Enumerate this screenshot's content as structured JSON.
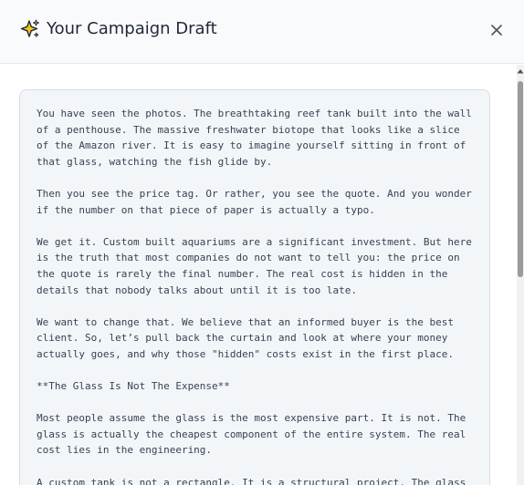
{
  "modal": {
    "title": "Your Campaign Draft",
    "title_icon": "sparkles-icon",
    "close_icon": "close-icon"
  },
  "draft": {
    "paragraphs": [
      "You have seen the photos. The breathtaking reef tank built into the wall of a penthouse. The massive freshwater biotope that looks like a slice of the Amazon river. It is easy to imagine yourself sitting in front of that glass, watching the fish glide by.",
      "Then you see the price tag. Or rather, you see the quote. And you wonder if the number on that piece of paper is actually a typo.",
      "We get it. Custom built aquariums are a significant investment. But here is the truth that most companies do not want to tell you: the price on the quote is rarely the final number. The real cost is hidden in the details that nobody talks about until it is too late.",
      "We want to change that. We believe that an informed buyer is the best client. So, let’s pull back the curtain and look at where your money actually goes, and why those \"hidden\" costs exist in the first place.",
      "**The Glass Is Not The Expense**",
      "Most people assume the glass is the most expensive part. It is not. The glass is actually the cheapest component of the entire system. The real cost lies in the engineering.",
      "A custom tank is not a rectangle. It is a structural project. The glass"
    ]
  },
  "colors": {
    "header_bg": "#f8fafc",
    "draft_bg": "#f3f6f9",
    "draft_border": "#d6dde5",
    "text": "#374151",
    "title": "#1f2937",
    "sparkle_gold": "#f5c518"
  }
}
